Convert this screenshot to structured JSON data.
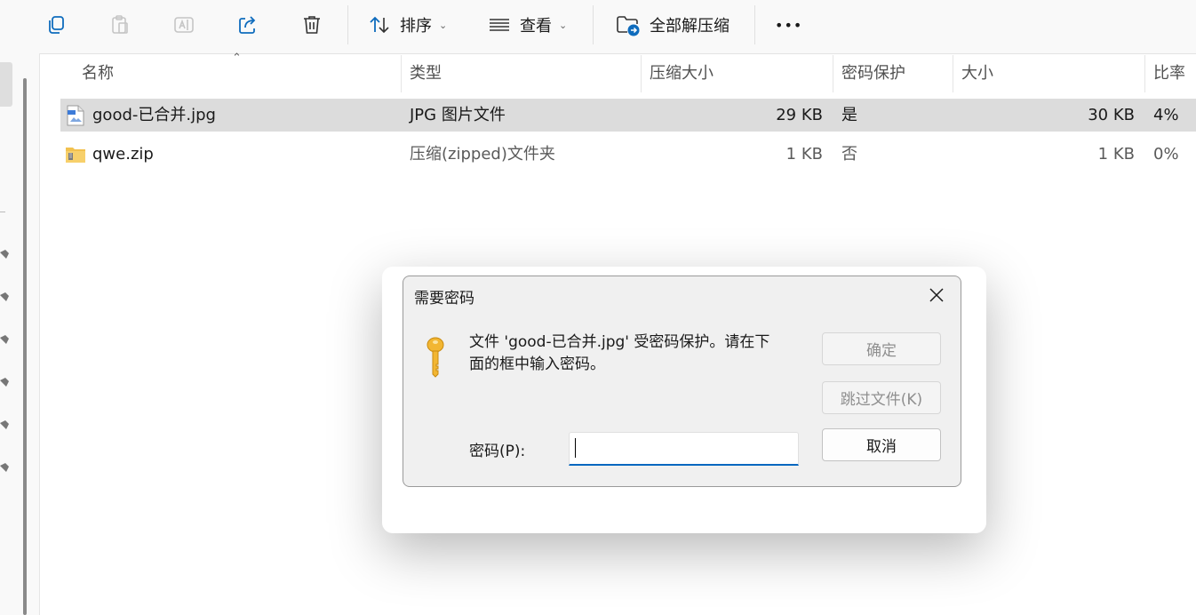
{
  "toolbar": {
    "sort_label": "排序",
    "view_label": "查看",
    "extract_label": "全部解压缩",
    "more_label": "•••"
  },
  "columns": {
    "name": "名称",
    "type": "类型",
    "compressed_size": "压缩大小",
    "password": "密码保护",
    "size": "大小",
    "ratio": "比率"
  },
  "files": [
    {
      "name": "good-已合并.jpg",
      "type": "JPG 图片文件",
      "compressed_size": "29 KB",
      "password": "是",
      "size": "30 KB",
      "ratio": "4%",
      "selected": true,
      "icon": "jpg-file-icon"
    },
    {
      "name": "qwe.zip",
      "type": "压缩(zipped)文件夹",
      "compressed_size": "1 KB",
      "password": "否",
      "size": "1 KB",
      "ratio": "0%",
      "selected": false,
      "icon": "zip-folder-icon"
    }
  ],
  "dialog": {
    "title": "需要密码",
    "message_line1": "文件 'good-已合并.jpg' 受密码保护。请在下",
    "message_line2": "面的框中输入密码。",
    "ok_label": "确定",
    "skip_label": "跳过文件(K)",
    "cancel_label": "取消",
    "password_label": "密码(P):",
    "password_value": ""
  },
  "colors": {
    "accent": "#0067c0",
    "selection": "#dcdcdc",
    "toolbar_bg": "#f9f9f9",
    "dialog_bg": "#f0f0f0"
  }
}
